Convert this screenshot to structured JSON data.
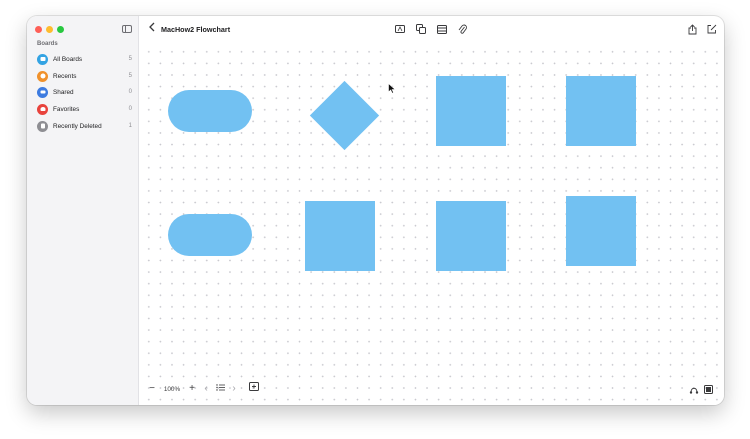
{
  "window": {
    "title": "MacHow2 Flowchart"
  },
  "sidebar": {
    "heading": "Boards",
    "items": [
      {
        "label": "All Boards",
        "count": "5",
        "color": "#33a3e3",
        "icon": "boards-icon"
      },
      {
        "label": "Recents",
        "count": "5",
        "color": "#f0912b",
        "icon": "clock-icon"
      },
      {
        "label": "Shared",
        "count": "0",
        "color": "#3d7be0",
        "icon": "people-icon"
      },
      {
        "label": "Favorites",
        "count": "0",
        "color": "#e8433d",
        "icon": "heart-icon"
      },
      {
        "label": "Recently Deleted",
        "count": "1",
        "color": "#8e8e93",
        "icon": "trash-icon"
      }
    ]
  },
  "toolbar": {
    "tools": [
      "text-box-icon",
      "shapes-icon",
      "media-icon",
      "attachment-icon"
    ],
    "right": [
      "share-icon",
      "new-board-icon"
    ]
  },
  "bottom_bar": {
    "zoom_out": "−",
    "zoom_level": "100%",
    "zoom_in": "+",
    "prev": "‹",
    "next": "›"
  },
  "colors": {
    "shape_fill": "#72c1f2"
  }
}
